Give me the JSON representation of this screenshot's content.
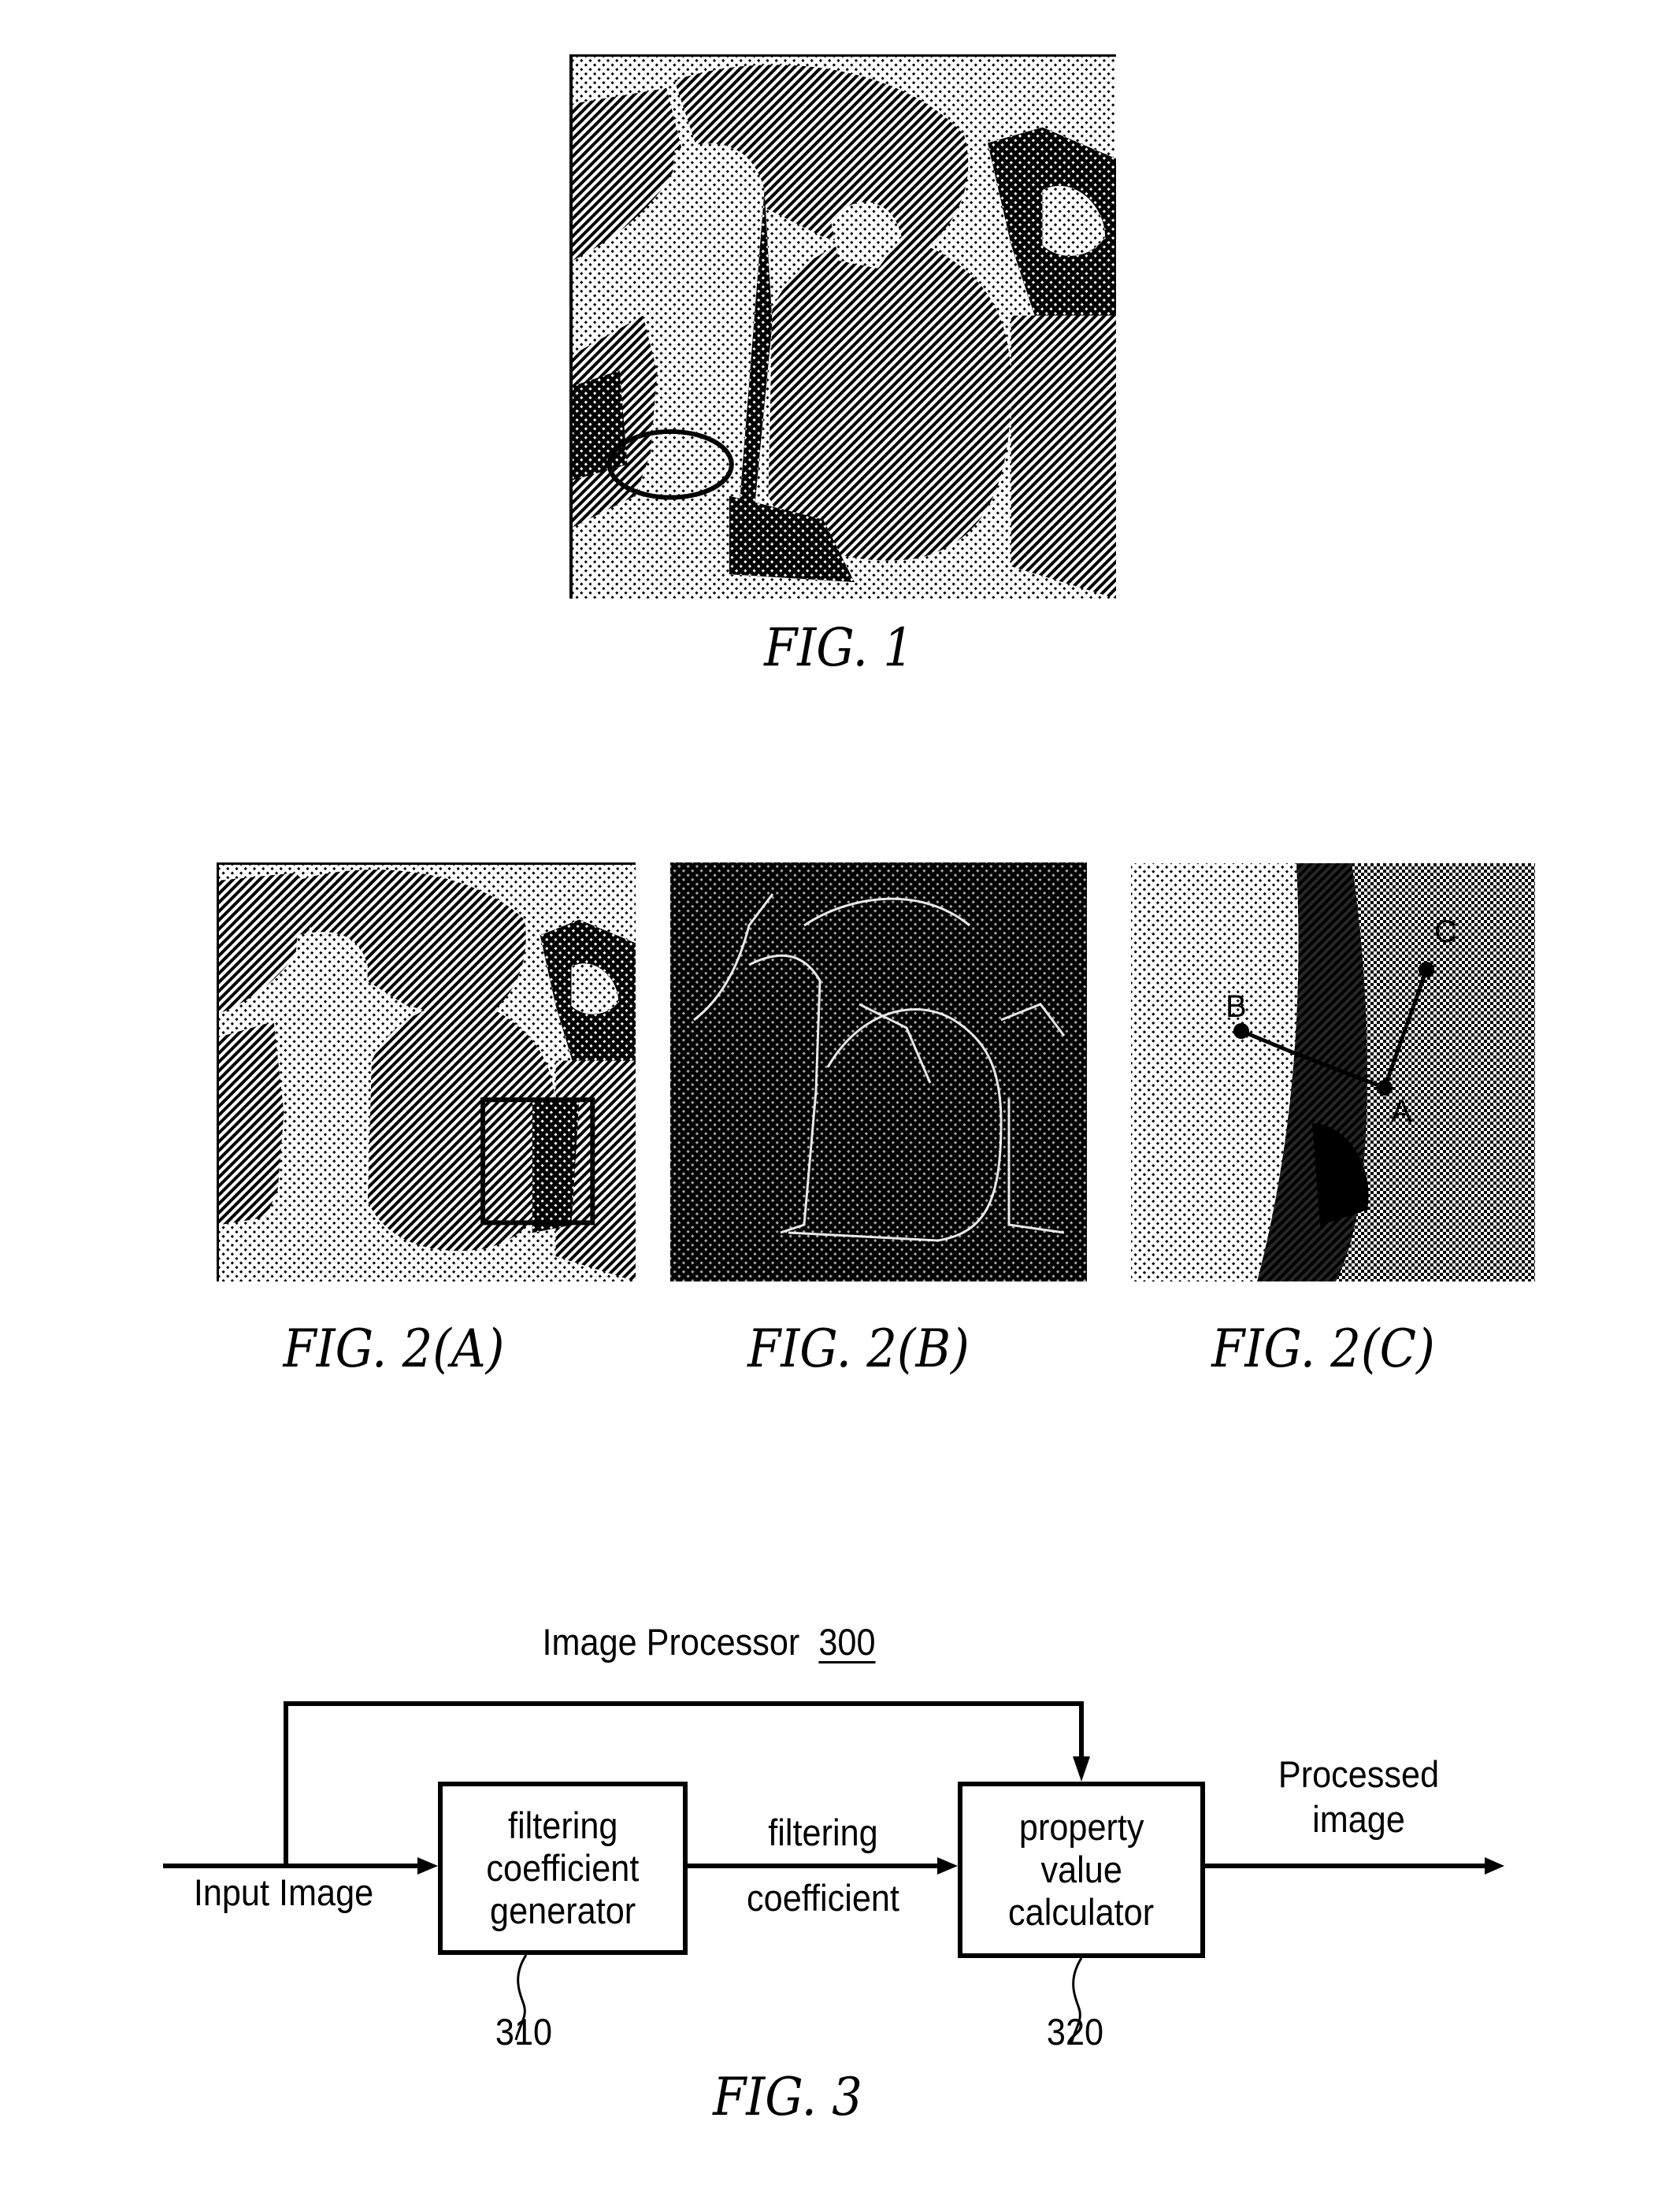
{
  "figures": {
    "fig1": {
      "caption": "FIG. 1",
      "image_description": "halftone photograph of bell peppers",
      "annotation": "ellipse-highlight"
    },
    "fig2a": {
      "caption": "FIG. 2(A)",
      "image_description": "halftone photograph of bell peppers",
      "annotation": "rectangle-highlight"
    },
    "fig2b": {
      "caption": "FIG. 2(B)",
      "image_description": "edge map of the peppers image"
    },
    "fig2c": {
      "caption": "FIG. 2(C)",
      "image_description": "enlarged crop of the highlighted region",
      "points": [
        {
          "label": "B"
        },
        {
          "label": "C"
        },
        {
          "label": "A"
        }
      ]
    },
    "fig3": {
      "caption": "FIG. 3",
      "title": "Image Processor",
      "title_ref": "300",
      "input_label": "Input Image",
      "blocks": [
        {
          "lines": [
            "filtering",
            "coefficient",
            "generator"
          ],
          "ref": "310"
        },
        {
          "lines": [
            "property",
            "value",
            "calculator"
          ],
          "ref": "320"
        }
      ],
      "edge_label_lines": [
        "filtering",
        "coefficient"
      ],
      "output_label_lines": [
        "Processed",
        "image"
      ]
    }
  }
}
